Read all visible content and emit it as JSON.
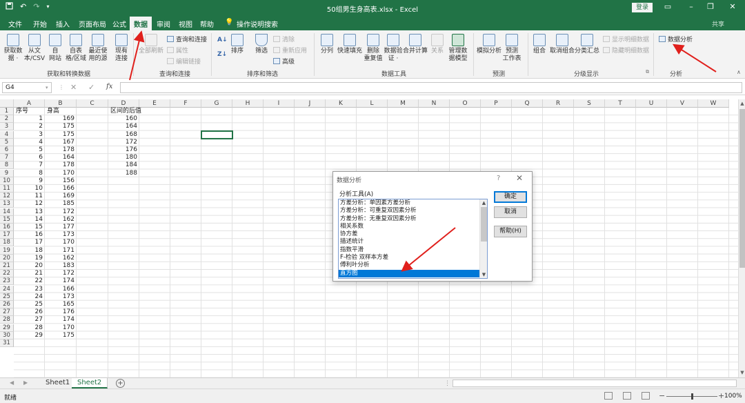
{
  "window": {
    "title": "50组男生身高表.xlsx  -  Excel",
    "login_label": "登录",
    "share_label": "共享",
    "qat": [
      "save-icon",
      "undo-icon",
      "redo-icon",
      "customize-icon"
    ],
    "controls": [
      "ribbon-display-icon",
      "minimize-icon",
      "restore-icon",
      "close-icon"
    ]
  },
  "menu": {
    "tabs": [
      "文件",
      "开始",
      "插入",
      "页面布局",
      "公式",
      "数据",
      "审阅",
      "视图",
      "帮助"
    ],
    "active_tab": "数据",
    "tell_me": "操作说明搜索"
  },
  "ribbon": {
    "groups": {
      "get_transform": {
        "label": "获取和转换数据",
        "buttons": [
          "获取数\n据 ·",
          "从文\n本/CSV",
          "自\n网站",
          "自表\n格/区域",
          "最近使\n用的源",
          "现有\n连接"
        ]
      },
      "queries": {
        "label": "查询和连接",
        "refresh": "全部刷新",
        "items": [
          "查询和连接",
          "属性",
          "编辑链接"
        ]
      },
      "sort_filter": {
        "label": "排序和筛选",
        "sort": "排序",
        "filter": "筛选",
        "items": [
          "清除",
          "重新应用",
          "高级"
        ]
      },
      "data_tools": {
        "label": "数据工具",
        "buttons": [
          "分列",
          "快速填充",
          "删除\n重复值",
          "数据验\n证 ·",
          "合并计算",
          "关系",
          "管理数\n据模型"
        ]
      },
      "forecast": {
        "label": "预测",
        "buttons": [
          "模拟分析",
          "预测\n工作表"
        ]
      },
      "outline": {
        "label": "分级显示",
        "buttons": [
          "组合",
          "取消组合",
          "分类汇总"
        ],
        "items": [
          "显示明细数据",
          "隐藏明细数据"
        ]
      },
      "analysis": {
        "label": "分析",
        "button": "数据分析"
      }
    }
  },
  "formula_bar": {
    "name_box": "G4",
    "fx": "fx",
    "value": ""
  },
  "sheet": {
    "columns": [
      "A",
      "B",
      "C",
      "D",
      "E",
      "F",
      "G",
      "H",
      "I",
      "J",
      "K",
      "L",
      "M",
      "N",
      "O",
      "P",
      "Q",
      "R",
      "S",
      "T",
      "U",
      "V",
      "W"
    ],
    "rows": [
      "1",
      "2",
      "3",
      "4",
      "5",
      "6",
      "7",
      "8",
      "9",
      "10",
      "11",
      "12",
      "13",
      "14",
      "15",
      "16",
      "17",
      "18",
      "19",
      "20",
      "21",
      "22",
      "23",
      "24",
      "25",
      "26",
      "27",
      "28",
      "29",
      "30",
      "31"
    ],
    "header_a": "序号",
    "header_b": "身高",
    "header_d": "区间的后值",
    "col_a": [
      "1",
      "2",
      "3",
      "4",
      "5",
      "6",
      "7",
      "8",
      "9",
      "10",
      "11",
      "12",
      "13",
      "14",
      "15",
      "16",
      "17",
      "18",
      "19",
      "20",
      "21",
      "22",
      "23",
      "24",
      "25",
      "26",
      "27",
      "28",
      "29"
    ],
    "col_b": [
      "169",
      "175",
      "175",
      "167",
      "178",
      "164",
      "178",
      "170",
      "156",
      "166",
      "169",
      "185",
      "172",
      "162",
      "177",
      "173",
      "170",
      "171",
      "162",
      "183",
      "172",
      "174",
      "166",
      "173",
      "165",
      "176",
      "174",
      "170",
      "175"
    ],
    "col_d": [
      "160",
      "164",
      "168",
      "172",
      "176",
      "180",
      "184",
      "188"
    ],
    "tabs": [
      "Sheet1",
      "Sheet2"
    ],
    "active_tab": "Sheet2"
  },
  "dialog": {
    "title": "数据分析",
    "help_q": "?",
    "close": "✕",
    "list_label": "分析工具(A)",
    "items": [
      "方差分析：单因素方差分析",
      "方差分析：可重复双因素分析",
      "方差分析：无重复双因素分析",
      "相关系数",
      "协方差",
      "描述统计",
      "指数平滑",
      "F-检验 双样本方差",
      "傅利叶分析",
      "直方图"
    ],
    "selected": "直方图",
    "ok": "确定",
    "cancel": "取消",
    "help": "帮助(H)"
  },
  "status": {
    "ready": "就绪",
    "zoom": "100%",
    "minus": "−",
    "plus": "+"
  },
  "colors": {
    "excel_green": "#217346",
    "selection_blue": "#0078d7",
    "annotation_red": "#e0201c"
  }
}
